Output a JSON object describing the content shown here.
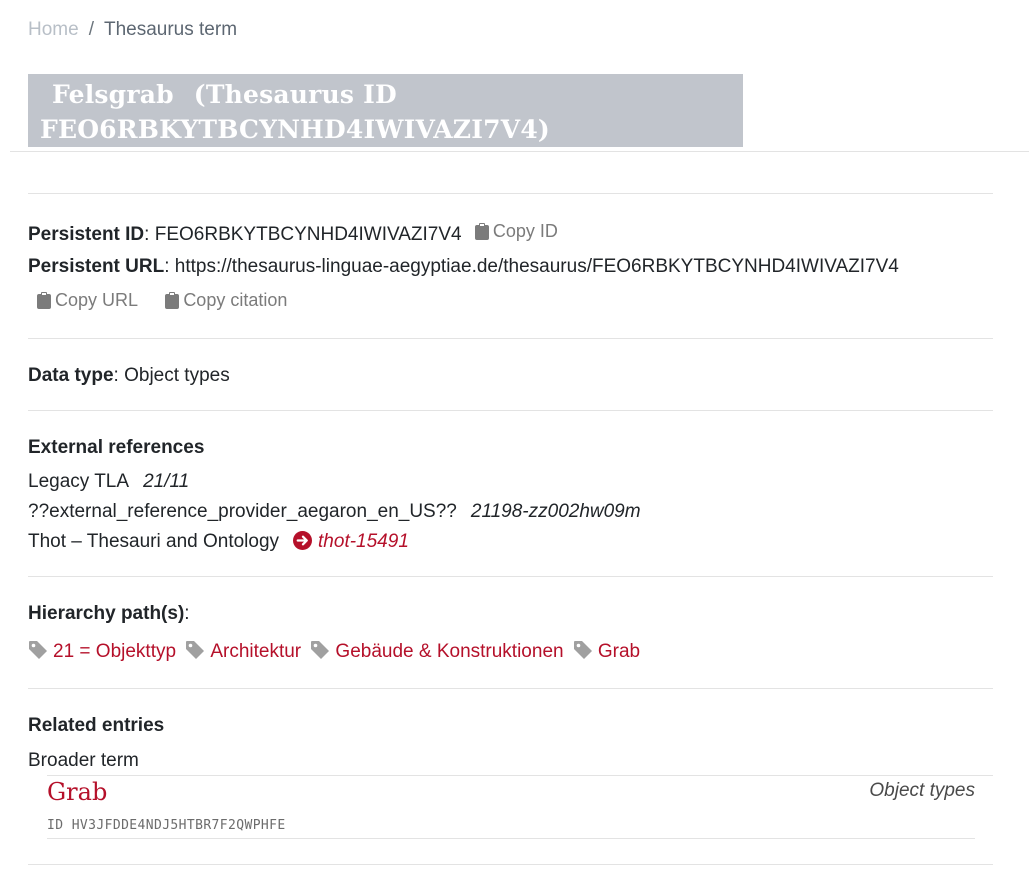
{
  "breadcrumb": {
    "home": "Home",
    "separator": "/",
    "current": "Thesaurus term"
  },
  "title": {
    "lemma": "Felsgrab",
    "id_text": "(Thesaurus ID FEO6RBKYTBCYNHD4IWIVAZI7V4)"
  },
  "persistent": {
    "id_label": "Persistent ID",
    "id_value": "FEO6RBKYTBCYNHD4IWIVAZI7V4",
    "copy_id": "Copy ID",
    "url_label": "Persistent URL",
    "url_value": "https://thesaurus-linguae-aegyptiae.de/thesaurus/FEO6RBKYTBCYNHD4IWIVAZI7V4",
    "copy_url": "Copy URL",
    "copy_citation": "Copy citation"
  },
  "data_type": {
    "label": "Data type",
    "value": "Object types"
  },
  "external_references": {
    "title": "External references",
    "items": [
      {
        "provider": "Legacy TLA",
        "id": "21/11"
      },
      {
        "provider": "??external_reference_provider_aegaron_en_US??",
        "id": "21198-zz002hw09m"
      },
      {
        "provider": "Thot – Thesauri and Ontology",
        "id": "thot-15491",
        "icon": "arrow-circle-right-icon"
      }
    ]
  },
  "hierarchy": {
    "title": "Hierarchy path(s)",
    "items": [
      "21 = Objekttyp",
      "Architektur",
      "Gebäude & Konstruktionen",
      "Grab"
    ]
  },
  "related": {
    "title": "Related entries",
    "broader_label": "Broader term",
    "entries": [
      {
        "lemma": "Grab",
        "type": "Object types",
        "id_label": "ID",
        "id": "HV3JFDDE4NDJ5HTBR7F2QWPHFE"
      }
    ]
  },
  "colors": {
    "accent": "#b5102a",
    "title_bg": "#c1c5cc",
    "muted": "#7b7b7b"
  }
}
